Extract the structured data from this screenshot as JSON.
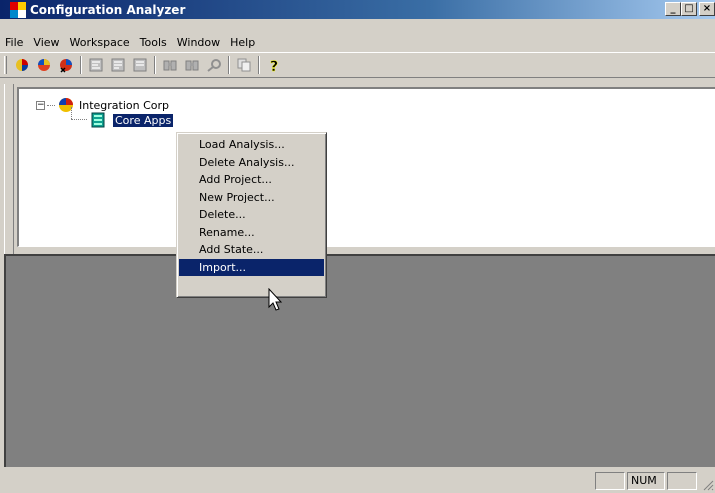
{
  "window": {
    "title": "Configuration Analyzer",
    "minimize_glyph": "_",
    "maximize_glyph": "□",
    "close_glyph": "×"
  },
  "menubar": {
    "items": [
      "File",
      "View",
      "Workspace",
      "Tools",
      "Window",
      "Help"
    ]
  },
  "toolbar": {
    "icons": [
      "analysis-pie-icon",
      "analysis-pie-red-icon",
      "analysis-pie-delete-icon",
      "tree-doc-icon",
      "tree-doc-2-icon",
      "tree-doc-3-icon",
      "binoculars-icon",
      "binoculars-2-icon",
      "key-search-icon",
      "copy-icon",
      "help-icon"
    ]
  },
  "tree": {
    "root": {
      "label": "Integration Corp",
      "expander": "−",
      "icon": "pie-chart-icon"
    },
    "child": {
      "label": "Core Apps",
      "icon": "server-icon"
    }
  },
  "context_menu": {
    "items": [
      "Load Analysis...",
      "Delete Analysis...",
      "Add Project...",
      "New Project...",
      "Delete...",
      "Rename...",
      "Add State...",
      "Import..."
    ],
    "highlighted_index": 7
  },
  "statusbar": {
    "num_indicator": "NUM"
  },
  "colors": {
    "title_bar": "#0a246a",
    "selection": "#0a246a",
    "face": "#d4d0c8",
    "workspace": "#808080"
  }
}
